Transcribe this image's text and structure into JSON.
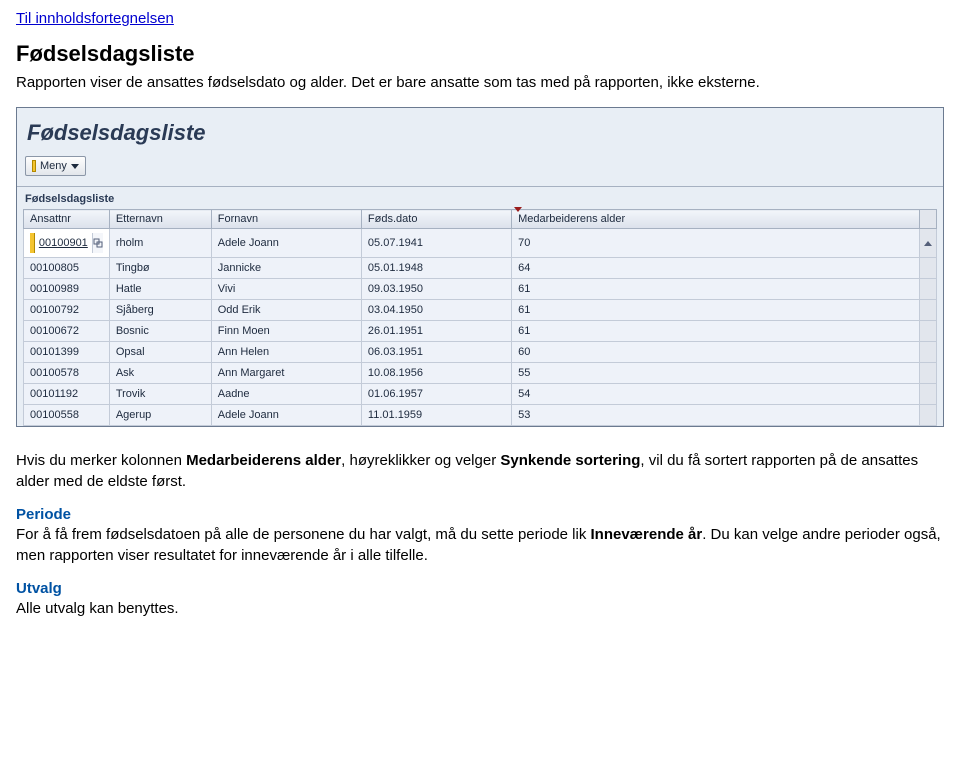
{
  "toc_link": "Til innholdsfortegnelsen",
  "heading": "Fødselsdagsliste",
  "intro": "Rapporten viser de ansattes fødselsdato og alder. Det er bare ansatte som tas med på rapporten, ikke eksterne.",
  "app": {
    "title": "Fødselsdagsliste",
    "meny_label": "Meny",
    "table_title": "Fødselsdagsliste",
    "columns": {
      "ansattnr": "Ansattnr",
      "etternavn": "Etternavn",
      "fornavn": "Fornavn",
      "fodsdato": "Føds.dato",
      "alder": "Medarbeiderens alder"
    },
    "rows": [
      {
        "ansattnr": "00100901",
        "etternavn": "rholm",
        "fornavn": "Adele Joann",
        "fodsdato": "05.07.1941",
        "alder": "70"
      },
      {
        "ansattnr": "00100805",
        "etternavn": "Tingbø",
        "fornavn": "Jannicke",
        "fodsdato": "05.01.1948",
        "alder": "64"
      },
      {
        "ansattnr": "00100989",
        "etternavn": "Hatle",
        "fornavn": "Vivi",
        "fodsdato": "09.03.1950",
        "alder": "61"
      },
      {
        "ansattnr": "00100792",
        "etternavn": "Sjåberg",
        "fornavn": "Odd Erik",
        "fodsdato": "03.04.1950",
        "alder": "61"
      },
      {
        "ansattnr": "00100672",
        "etternavn": "Bosnic",
        "fornavn": "Finn Moen",
        "fodsdato": "26.01.1951",
        "alder": "61"
      },
      {
        "ansattnr": "00101399",
        "etternavn": "Opsal",
        "fornavn": "Ann Helen",
        "fodsdato": "06.03.1951",
        "alder": "60"
      },
      {
        "ansattnr": "00100578",
        "etternavn": "Ask",
        "fornavn": "Ann Margaret",
        "fodsdato": "10.08.1956",
        "alder": "55"
      },
      {
        "ansattnr": "00101192",
        "etternavn": "Trovik",
        "fornavn": "Aadne",
        "fodsdato": "01.06.1957",
        "alder": "54"
      },
      {
        "ansattnr": "00100558",
        "etternavn": "Agerup",
        "fornavn": "Adele Joann",
        "fodsdato": "11.01.1959",
        "alder": "53"
      }
    ]
  },
  "para1_pre": "Hvis du merker kolonnen ",
  "para1_b1": "Medarbeiderens alder",
  "para1_mid": ", høyreklikker og velger ",
  "para1_b2": "Synkende sortering",
  "para1_post": ", vil du få sortert rapporten på de ansattes alder med de eldste først.",
  "periode_head": "Periode",
  "periode_pre": "For å få frem fødselsdatoen på alle de personene du har valgt, må du sette periode lik ",
  "periode_b": "Inneværende år",
  "periode_post": ". Du kan velge andre perioder også, men rapporten viser resultatet for inneværende år i alle tilfelle.",
  "utvalg_head": "Utvalg",
  "utvalg_text": "Alle utvalg kan benyttes."
}
